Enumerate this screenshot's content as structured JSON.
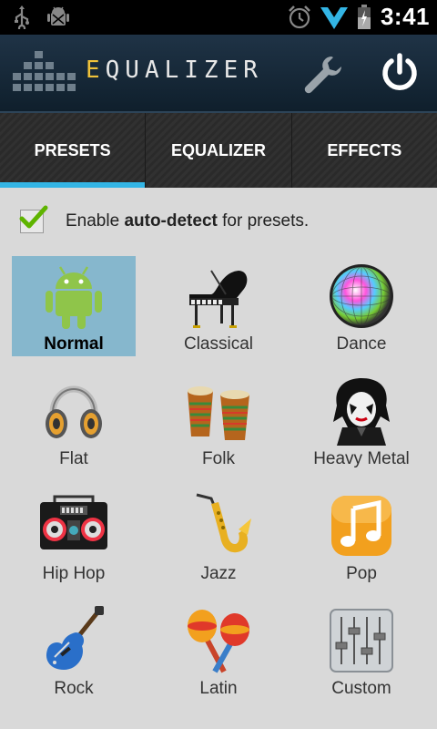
{
  "status_bar": {
    "time": "3:41",
    "icons": [
      "usb-icon",
      "debug-icon",
      "alarm-icon",
      "signal-icon",
      "battery-icon"
    ]
  },
  "header": {
    "title": "EQUALIZER",
    "title_first_letter": "E",
    "title_rest": "QUALIZER",
    "accent_color": "#f0c23a"
  },
  "tabs": [
    {
      "label": "PRESETS",
      "active": true
    },
    {
      "label": "EQUALIZER",
      "active": false
    },
    {
      "label": "EFFECTS",
      "active": false
    }
  ],
  "auto_detect": {
    "checked": true,
    "prefix": "Enable ",
    "bold": "auto-detect",
    "suffix": " for presets."
  },
  "presets": [
    {
      "label": "Normal",
      "icon": "android-icon",
      "selected": true
    },
    {
      "label": "Classical",
      "icon": "piano-icon",
      "selected": false
    },
    {
      "label": "Dance",
      "icon": "disco-ball-icon",
      "selected": false
    },
    {
      "label": "Flat",
      "icon": "headphones-icon",
      "selected": false
    },
    {
      "label": "Folk",
      "icon": "bongo-drums-icon",
      "selected": false
    },
    {
      "label": "Heavy Metal",
      "icon": "metal-face-icon",
      "selected": false
    },
    {
      "label": "Hip Hop",
      "icon": "boombox-icon",
      "selected": false
    },
    {
      "label": "Jazz",
      "icon": "saxophone-icon",
      "selected": false
    },
    {
      "label": "Pop",
      "icon": "music-note-icon",
      "selected": false
    },
    {
      "label": "Rock",
      "icon": "electric-guitar-icon",
      "selected": false
    },
    {
      "label": "Latin",
      "icon": "maracas-icon",
      "selected": false
    },
    {
      "label": "Custom",
      "icon": "sliders-icon",
      "selected": false
    }
  ],
  "colors": {
    "tab_indicator": "#33b5e5",
    "selected_cell": "#86b7cd",
    "checkmark": "#5fb400"
  }
}
